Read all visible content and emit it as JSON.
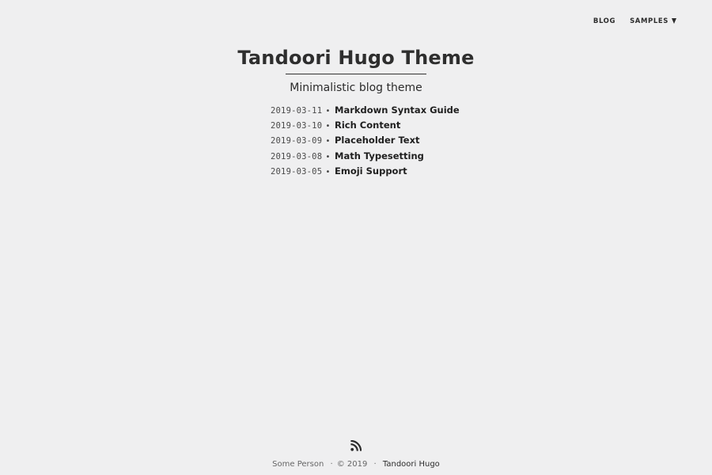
{
  "nav": {
    "blog_label": "BLOG",
    "samples_label": "SAMPLES",
    "samples_icon": "caret-down-icon"
  },
  "header": {
    "title": "Tandoori Hugo Theme",
    "subtitle": "Minimalistic blog theme"
  },
  "posts": [
    {
      "date": "2019-03-11",
      "separator": "•",
      "title": "Markdown Syntax Guide"
    },
    {
      "date": "2019-03-10",
      "separator": "•",
      "title": "Rich Content"
    },
    {
      "date": "2019-03-09",
      "separator": "•",
      "title": "Placeholder Text"
    },
    {
      "date": "2019-03-08",
      "separator": "•",
      "title": "Math Typesetting"
    },
    {
      "date": "2019-03-05",
      "separator": "•",
      "title": "Emoji Support"
    }
  ],
  "footer": {
    "rss_icon": "rss-icon",
    "author": "Some Person",
    "copyright": "© 2019",
    "separator": "·",
    "theme_link": "Tandoori Hugo"
  },
  "colors": {
    "background": "#efeff0",
    "text": "#2b2b2b"
  }
}
